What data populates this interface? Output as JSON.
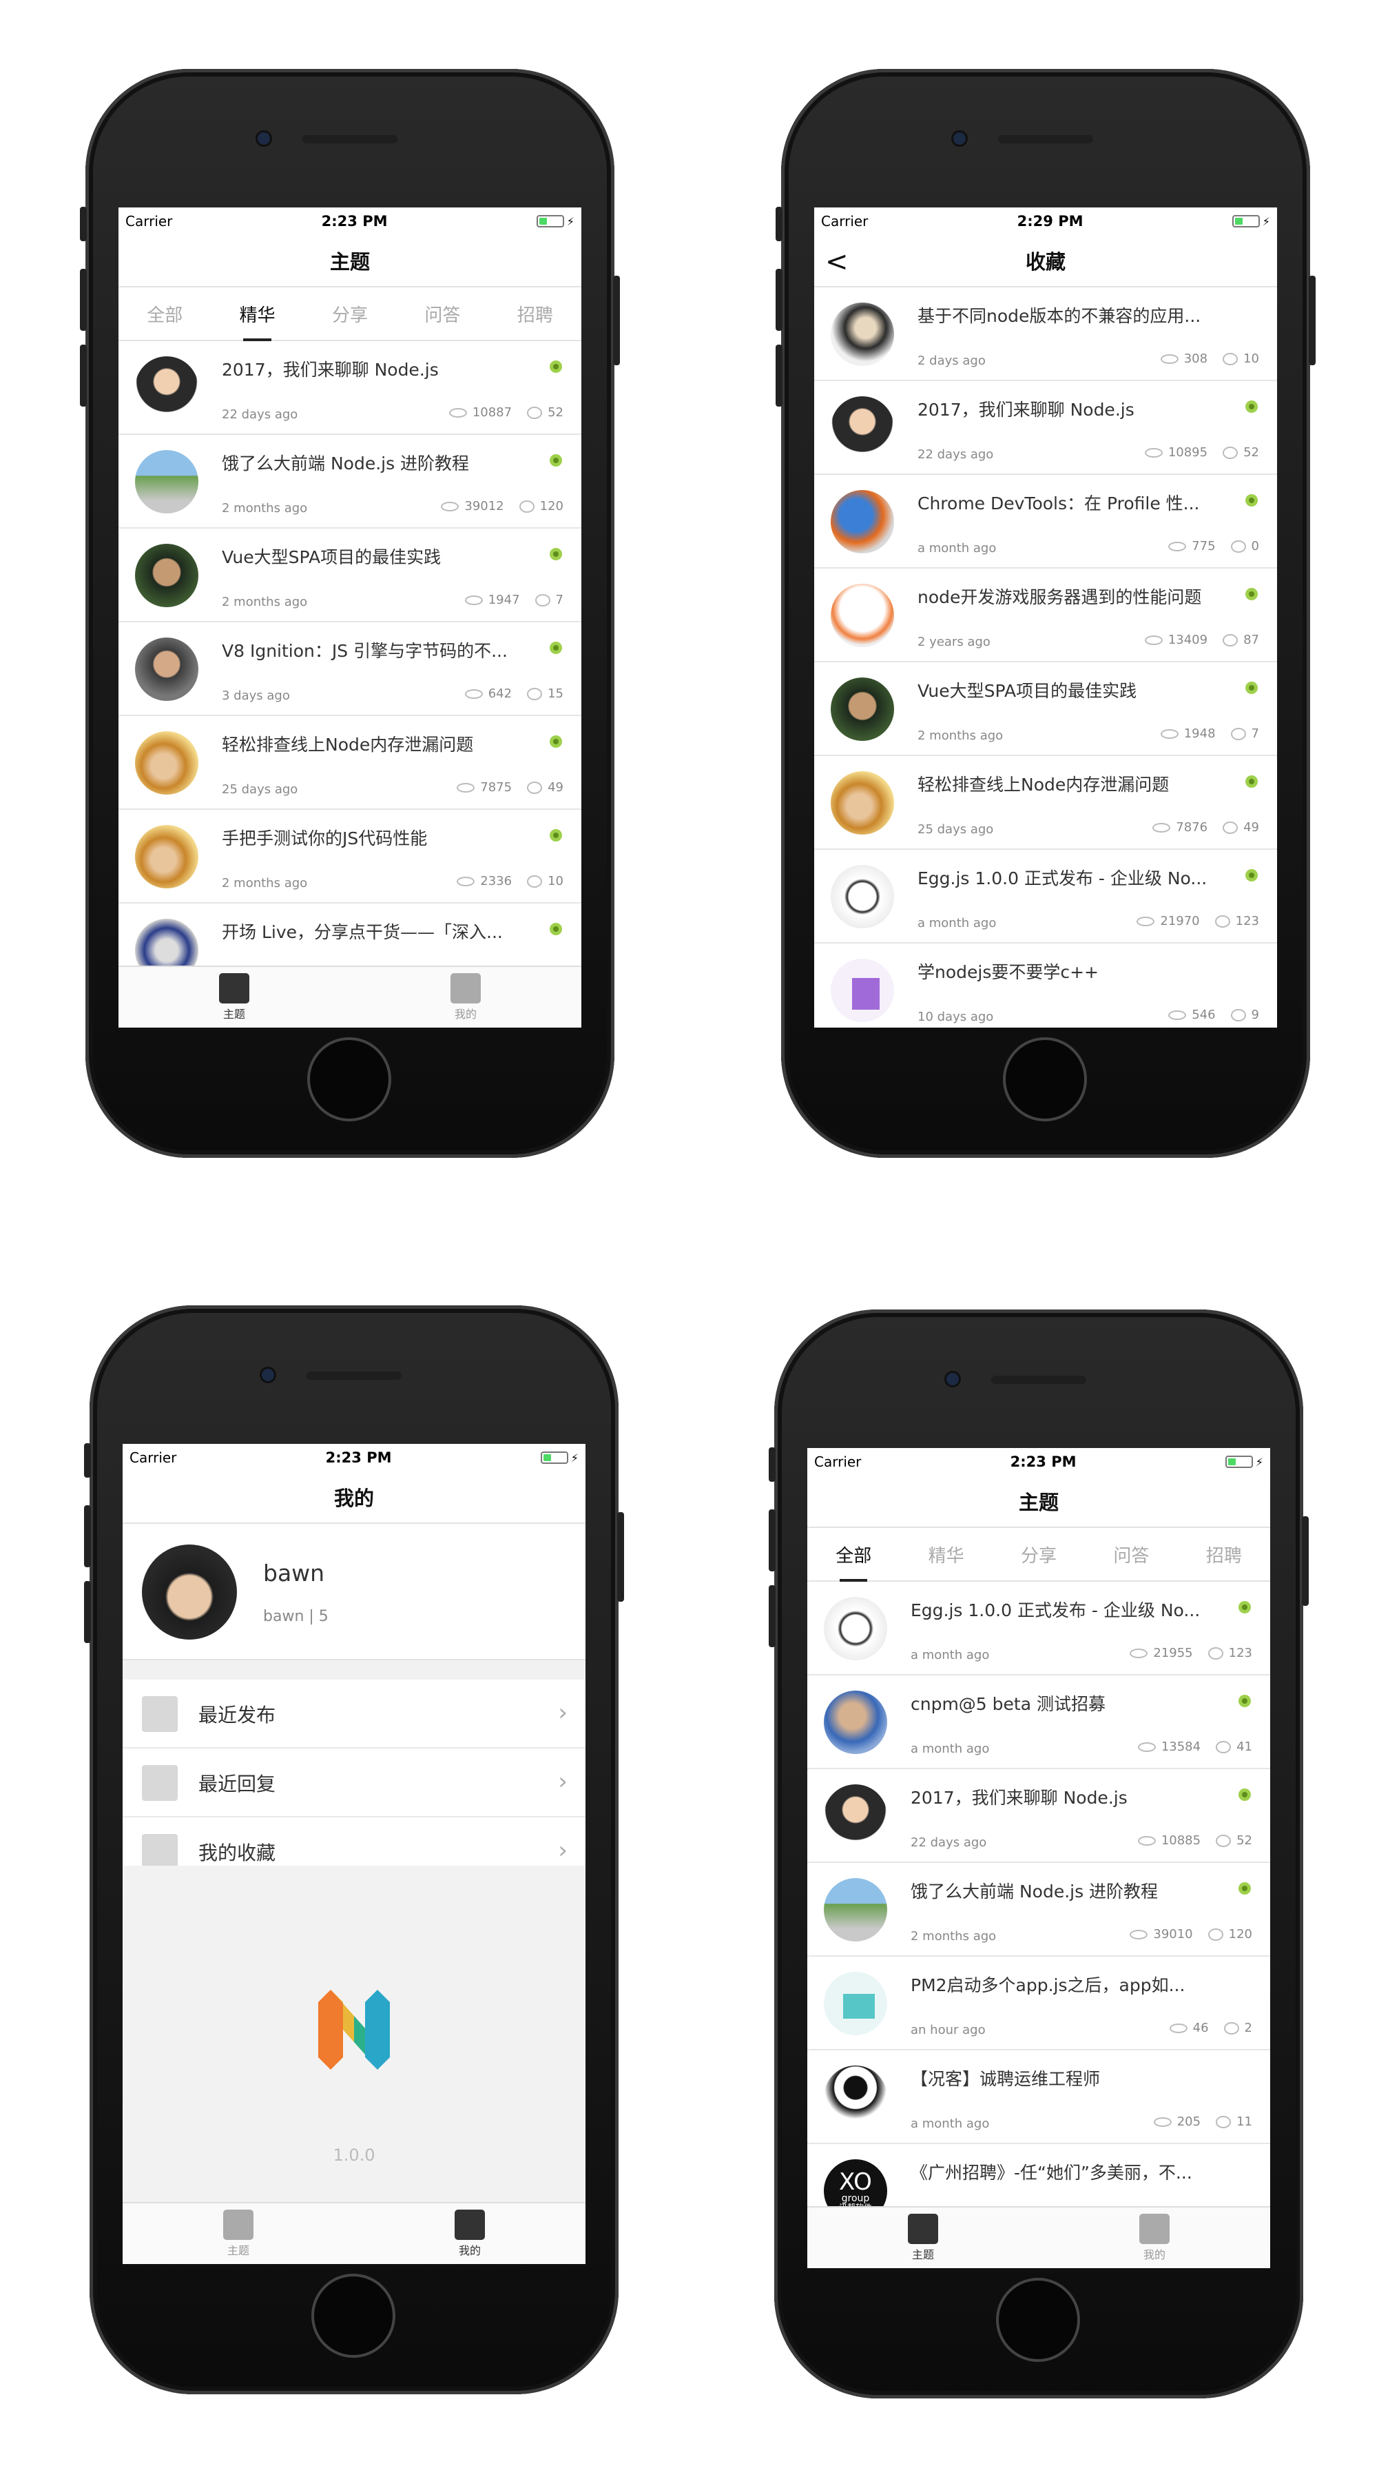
{
  "status": {
    "carrier": "Carrier",
    "bolt": "⚡",
    "time1": "2:23 PM",
    "time2": "2:29 PM",
    "time3": "2:23 PM",
    "time4": "2:23 PM"
  },
  "p1": {
    "title": "主题",
    "tabs": [
      "全部",
      "精华",
      "分享",
      "问答",
      "招聘"
    ],
    "rows": [
      {
        "title": "2017，我们来聊聊 Node.js",
        "age": "22 days ago",
        "views": "10887",
        "replies": "52"
      },
      {
        "title": "饿了么大前端 Node.js 进阶教程",
        "age": "2 months ago",
        "views": "39012",
        "replies": "120"
      },
      {
        "title": "Vue大型SPA项目的最佳实践",
        "age": "2 months ago",
        "views": "1947",
        "replies": "7"
      },
      {
        "title": "V8 Ignition：JS 引擎与字节码的不...",
        "age": "3 days ago",
        "views": "642",
        "replies": "15"
      },
      {
        "title": "轻松排查线上Node内存泄漏问题",
        "age": "25 days ago",
        "views": "7875",
        "replies": "49"
      },
      {
        "title": "手把手测试你的JS代码性能",
        "age": "2 months ago",
        "views": "2336",
        "replies": "10"
      },
      {
        "title": "开场 Live，分享点干货——「深入...",
        "age": "",
        "views": "",
        "replies": ""
      }
    ],
    "tabbar": [
      "主题",
      "我的"
    ]
  },
  "p2": {
    "title": "收藏",
    "back": "<",
    "rows": [
      {
        "title": "基于不同node版本的不兼容的应用...",
        "age": "2 days ago",
        "views": "308",
        "replies": "10"
      },
      {
        "title": "2017，我们来聊聊 Node.js",
        "age": "22 days ago",
        "views": "10895",
        "replies": "52"
      },
      {
        "title": "Chrome DevTools：在 Profile 性...",
        "age": "a month ago",
        "views": "775",
        "replies": "0"
      },
      {
        "title": "node开发游戏服务器遇到的性能问题",
        "age": "2 years ago",
        "views": "13409",
        "replies": "87"
      },
      {
        "title": "Vue大型SPA项目的最佳实践",
        "age": "2 months ago",
        "views": "1948",
        "replies": "7"
      },
      {
        "title": "轻松排查线上Node内存泄漏问题",
        "age": "25 days ago",
        "views": "7876",
        "replies": "49"
      },
      {
        "title": "Egg.js 1.0.0 正式发布 - 企业级 No...",
        "age": "a month ago",
        "views": "21970",
        "replies": "123"
      },
      {
        "title": "学nodejs要不要学c++",
        "age": "10 days ago",
        "views": "546",
        "replies": "9"
      }
    ]
  },
  "p3": {
    "title": "我的",
    "name": "bawn",
    "sub": "bawn | 5",
    "menu": [
      "最近发布",
      "最近回复",
      "我的收藏"
    ],
    "chev": "›",
    "version": "1.0.0",
    "tabbar": [
      "主题",
      "我的"
    ]
  },
  "p4": {
    "title": "主题",
    "tabs": [
      "全部",
      "精华",
      "分享",
      "问答",
      "招聘"
    ],
    "rows": [
      {
        "title": "Egg.js 1.0.0 正式发布 - 企业级 No...",
        "age": "a month ago",
        "views": "21955",
        "replies": "123"
      },
      {
        "title": "cnpm@5 beta 测试招募",
        "age": "a month ago",
        "views": "13584",
        "replies": "41"
      },
      {
        "title": "2017，我们来聊聊 Node.js",
        "age": "22 days ago",
        "views": "10885",
        "replies": "52"
      },
      {
        "title": "饿了么大前端 Node.js 进阶教程",
        "age": "2 months ago",
        "views": "39010",
        "replies": "120"
      },
      {
        "title": "PM2启动多个app.js之后，app如...",
        "age": "an hour ago",
        "views": "46",
        "replies": "2"
      },
      {
        "title": "【况客】诚聘运维工程师",
        "age": "a month ago",
        "views": "205",
        "replies": "11"
      },
      {
        "title": "《广州招聘》-任“她们”多美丽，不...",
        "age": "",
        "views": "",
        "replies": ""
      }
    ],
    "avatarText": [
      "XO",
      "group",
      "讯帮软件"
    ],
    "tabbar": [
      "主题",
      "我的"
    ]
  },
  "colors": {
    "badge": "#9fd04b",
    "accent": "#333333"
  }
}
